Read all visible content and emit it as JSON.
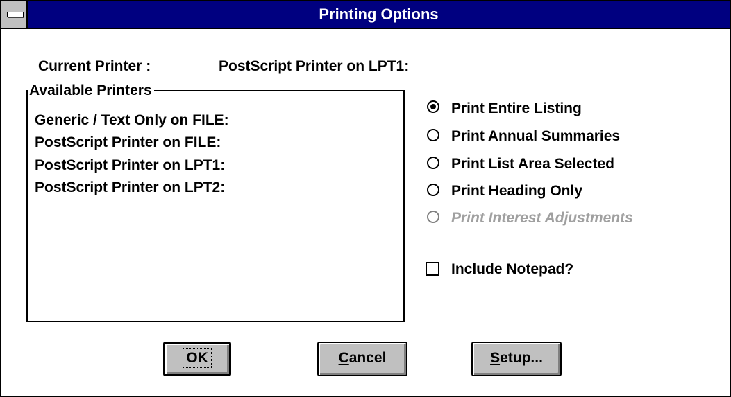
{
  "window": {
    "title": "Printing Options"
  },
  "current_printer": {
    "label": "Current Printer :",
    "value": "PostScript Printer on LPT1:"
  },
  "available_printers": {
    "label": "Available Printers",
    "items": [
      "Generic / Text Only on FILE:",
      "PostScript Printer on FILE:",
      "PostScript Printer on LPT1:",
      "PostScript Printer on LPT2:"
    ]
  },
  "print_options": [
    {
      "label": "Print Entire Listing",
      "checked": true,
      "enabled": true
    },
    {
      "label": "Print Annual Summaries",
      "checked": false,
      "enabled": true
    },
    {
      "label": "Print List Area Selected",
      "checked": false,
      "enabled": true
    },
    {
      "label": "Print Heading Only",
      "checked": false,
      "enabled": true
    },
    {
      "label": "Print Interest Adjustments",
      "checked": false,
      "enabled": false
    }
  ],
  "include_notepad": {
    "label": "Include Notepad?",
    "checked": false
  },
  "buttons": {
    "ok": "OK",
    "cancel_underline": "C",
    "cancel_rest": "ancel",
    "setup_underline": "S",
    "setup_rest": "etup..."
  }
}
